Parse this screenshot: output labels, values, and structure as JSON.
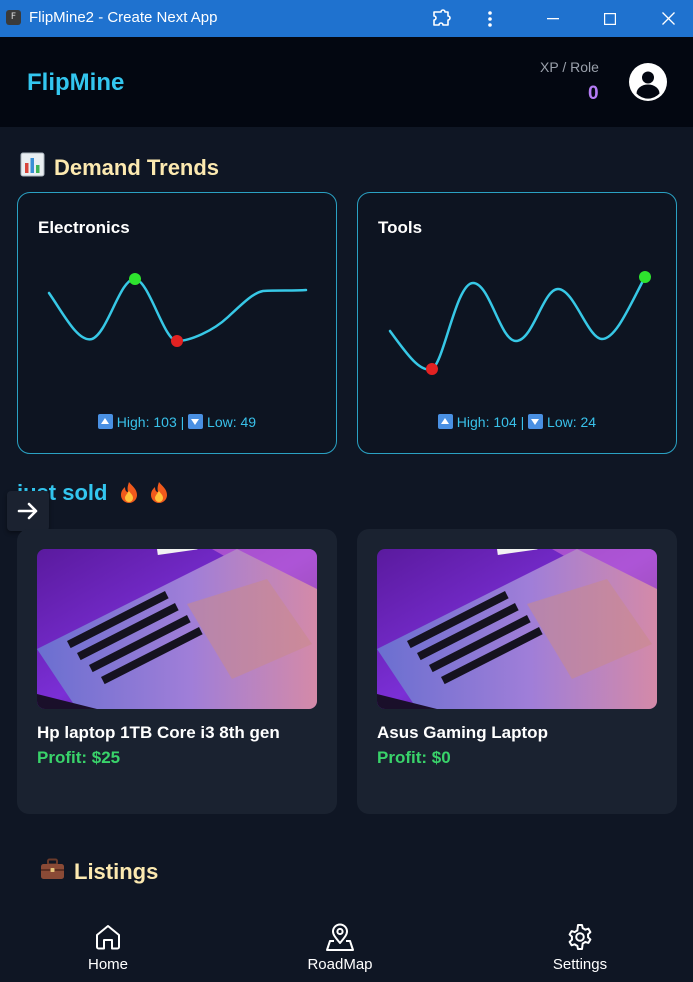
{
  "window": {
    "title": "FlipMine2 - Create Next App",
    "icon_letter": "F"
  },
  "header": {
    "brand": "FlipMine",
    "xp_label": "XP / Role",
    "xp_value": "0"
  },
  "demand": {
    "heading": "Demand Trends",
    "charts": [
      {
        "title": "Electronics",
        "high_label": "High:",
        "high": "103",
        "separator": "|",
        "low_label": "Low:",
        "low": "49"
      },
      {
        "title": "Tools",
        "high_label": "High:",
        "high": "104",
        "separator": "|",
        "low_label": "Low:",
        "low": "24"
      }
    ],
    "colors": {
      "line": "#37c8e6",
      "high_dot": "#2ee32e",
      "low_dot": "#e22222",
      "border": "#2aa1c3"
    }
  },
  "just_sold": {
    "heading": "just sold",
    "items": [
      {
        "name": "Hp laptop 1TB Core i3 8th gen",
        "profit": "Profit: $25"
      },
      {
        "name": "Asus Gaming Laptop",
        "profit": "Profit: $0"
      }
    ]
  },
  "listings": {
    "heading": "Listings"
  },
  "nav": {
    "home": "Home",
    "roadmap": "RoadMap",
    "settings": "Settings"
  },
  "icons": {
    "title_bar": [
      "app-icon",
      "extension-icon",
      "more-icon",
      "minimize-icon",
      "maximize-icon",
      "close-icon"
    ],
    "header": [
      "user-avatar-icon"
    ],
    "sections": [
      "bar-chart-icon",
      "fire-icon",
      "briefcase-icon",
      "arrow-right-icon"
    ],
    "nav": [
      "home-icon",
      "map-pin-icon",
      "gear-icon"
    ]
  }
}
